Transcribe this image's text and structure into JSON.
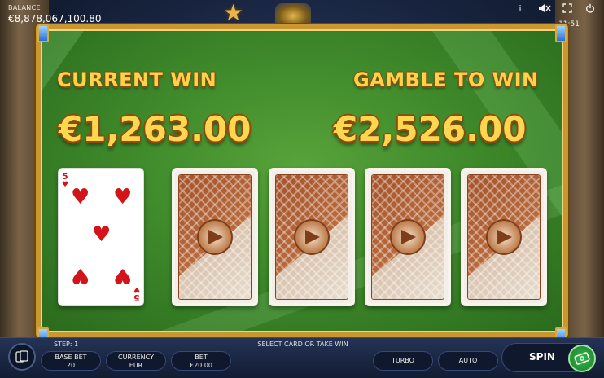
{
  "header": {
    "balance_label": "BALANCE",
    "balance_value": "€8,878,067,100.80",
    "time": "11:51",
    "icons": [
      "info-icon",
      "sound-muted-icon",
      "fullscreen-icon",
      "power-icon"
    ]
  },
  "gamble": {
    "current_win_label": "CURRENT WIN",
    "current_win_amount": "€1,263.00",
    "gamble_to_win_label": "GAMBLE TO WIN",
    "gamble_to_win_amount": "€2,526.00"
  },
  "cards": {
    "dealer_card": {
      "rank": "5",
      "suit": "hearts",
      "suit_symbol": "♥",
      "color": "#d3141b"
    },
    "face_down_count": 4
  },
  "controls": {
    "step_text": "STEP: 1",
    "instruction": "SELECT CARD OR TAKE WIN",
    "base_bet_label": "BASE BET",
    "base_bet_value": "20",
    "currency_label": "CURRENCY",
    "currency_value": "EUR",
    "bet_label": "BET",
    "bet_value": "€20.00",
    "turbo_label": "TURBO",
    "auto_label": "AUTO",
    "spin_label": "SPIN"
  },
  "colors": {
    "gold_text": "#ffd24a",
    "felt_green": "#3f8a2b",
    "frame_gold": "#c9962f",
    "bar_dark": "#121c32"
  }
}
